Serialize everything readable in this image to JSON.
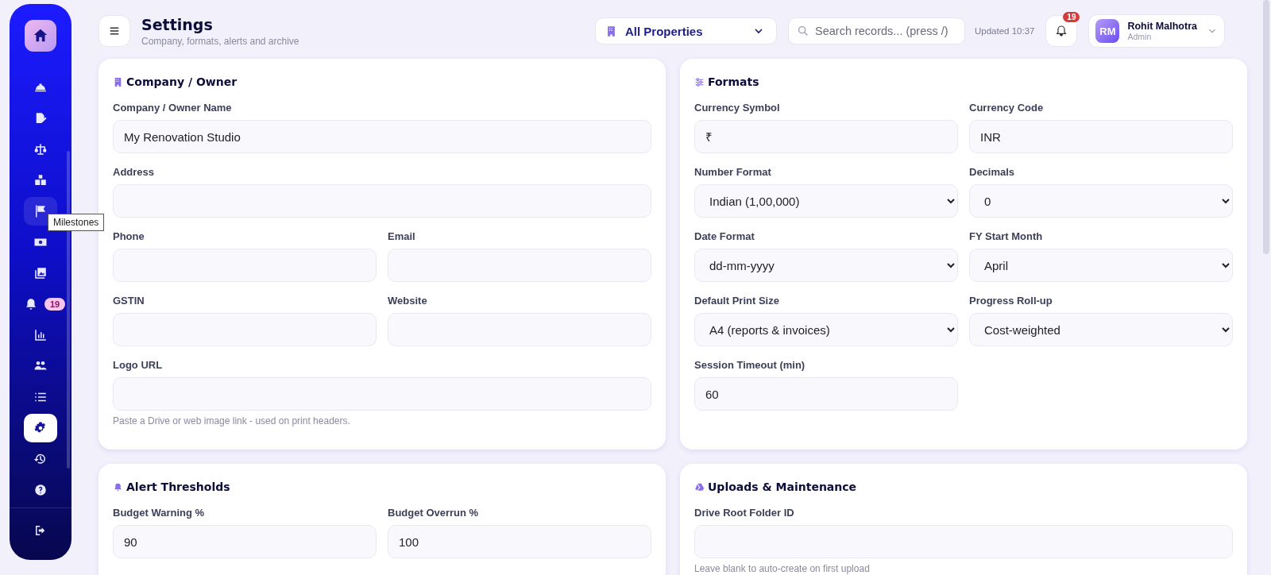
{
  "sidebar": {
    "items": [
      {
        "kind": "nav",
        "selected": false,
        "hovered": false
      },
      {
        "kind": "nav",
        "selected": false,
        "hovered": false
      },
      {
        "kind": "nav",
        "selected": false,
        "hovered": false
      },
      {
        "kind": "nav",
        "selected": false,
        "hovered": false
      },
      {
        "kind": "nav",
        "selected": false,
        "hovered": true
      },
      {
        "kind": "nav",
        "selected": false,
        "hovered": false
      },
      {
        "kind": "nav",
        "selected": false,
        "hovered": false
      },
      {
        "kind": "nav",
        "selected": false,
        "hovered": false,
        "badge": "19"
      },
      {
        "kind": "nav",
        "selected": false,
        "hovered": false
      },
      {
        "kind": "nav",
        "selected": false,
        "hovered": false
      },
      {
        "kind": "nav",
        "selected": false,
        "hovered": false
      },
      {
        "kind": "nav",
        "selected": true,
        "hovered": false
      },
      {
        "kind": "nav",
        "selected": false,
        "hovered": false
      },
      {
        "kind": "nav",
        "selected": false,
        "hovered": false
      },
      {
        "kind": "footer",
        "selected": false,
        "hovered": false
      }
    ],
    "tooltip": "Milestones"
  },
  "header": {
    "title": "Settings",
    "subtitle": "Company, formats, alerts and archive",
    "property": "All Properties",
    "search": {
      "placeholder": "Search records... (press /)"
    },
    "updated": "Updated 10:37",
    "notifications": "19",
    "user": {
      "initials": "RM",
      "name": "Rohit Malhotra",
      "role": "Admin"
    }
  },
  "sections": [
    {
      "kind": "company",
      "title": "Company / Owner",
      "rows": [
        [
          {
            "kind": "text",
            "label": "Company / Owner Name",
            "value": "My Renovation Studio"
          }
        ],
        [
          {
            "kind": "text",
            "label": "Address"
          }
        ],
        [
          {
            "kind": "text",
            "label": "Phone"
          },
          {
            "kind": "text",
            "label": "Email"
          }
        ],
        [
          {
            "kind": "text",
            "label": "GSTIN"
          },
          {
            "kind": "text",
            "label": "Website"
          }
        ],
        [
          {
            "kind": "text",
            "label": "Logo URL",
            "hint": "Paste a Drive or web image link - used on print headers."
          }
        ]
      ]
    },
    {
      "kind": "formats",
      "title": "Formats",
      "rows": [
        [
          {
            "kind": "text",
            "label": "Currency Symbol",
            "value": "₹"
          },
          {
            "kind": "text",
            "label": "Currency Code",
            "value": "INR"
          }
        ],
        [
          {
            "kind": "select",
            "label": "Number Format",
            "value": "Indian (1,00,000)"
          },
          {
            "kind": "select",
            "label": "Decimals",
            "value": "0"
          }
        ],
        [
          {
            "kind": "select",
            "label": "Date Format",
            "value": "dd-mm-yyyy"
          },
          {
            "kind": "select",
            "label": "FY Start Month",
            "value": "April"
          }
        ],
        [
          {
            "kind": "select",
            "label": "Default Print Size",
            "value": "A4 (reports & invoices)"
          },
          {
            "kind": "select",
            "label": "Progress Roll-up",
            "value": "Cost-weighted"
          }
        ],
        [
          {
            "kind": "text",
            "label": "Session Timeout (min)",
            "value": "60"
          }
        ]
      ]
    },
    {
      "kind": "alerts",
      "title": "Alert Thresholds",
      "rows": [
        [
          {
            "kind": "text",
            "label": "Budget Warning %",
            "value": "90"
          },
          {
            "kind": "text",
            "label": "Budget Overrun %",
            "value": "100"
          }
        ]
      ]
    },
    {
      "kind": "uploads",
      "title": "Uploads & Maintenance",
      "rows": [
        [
          {
            "kind": "text",
            "label": "Drive Root Folder ID",
            "hint": "Leave blank to auto-create on first upload"
          }
        ]
      ]
    }
  ]
}
